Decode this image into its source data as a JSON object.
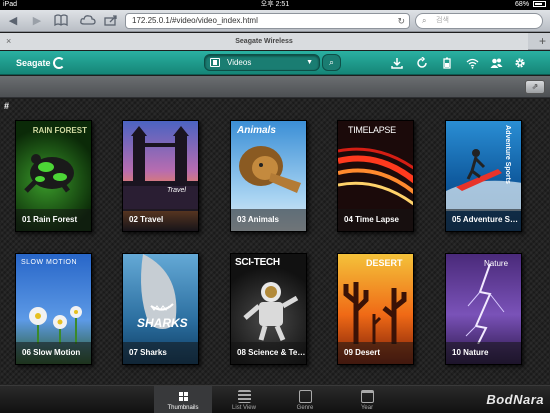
{
  "status": {
    "device": "iPad",
    "time": "오후 2:51",
    "battery": "68%"
  },
  "browser": {
    "url": "172.25.0.1/#video/video_index.html",
    "search_placeholder": "검색",
    "tab_title": "Seagate Wireless"
  },
  "app": {
    "logo": "Seagate",
    "category": "Videos",
    "header_icons": [
      "download-icon",
      "sync-icon",
      "battery-icon",
      "wifi-icon",
      "users-icon",
      "gear-icon"
    ],
    "section_index": "#"
  },
  "videos": [
    {
      "label": "01 Rain Forest",
      "poster": "RAIN FOREST"
    },
    {
      "label": "02 Travel",
      "poster": "Travel"
    },
    {
      "label": "03 Animals",
      "poster": "Animals"
    },
    {
      "label": "04 Time Lapse",
      "poster": "TIMELAPSE"
    },
    {
      "label": "05 Adventure Sp...",
      "poster": "Adventure Sports"
    },
    {
      "label": "06 Slow Motion",
      "poster": "SLOW MOTION"
    },
    {
      "label": "07 Sharks",
      "poster": "SHARKS"
    },
    {
      "label": "08 Science & Tec...",
      "poster": "SCI-TECH"
    },
    {
      "label": "09 Desert",
      "poster": "DESERT"
    },
    {
      "label": "10 Nature",
      "poster": "Nature"
    }
  ],
  "bottom_tabs": [
    {
      "label": "Thumbnails",
      "active": true
    },
    {
      "label": "List View",
      "active": false
    },
    {
      "label": "Genre",
      "active": false
    },
    {
      "label": "Year",
      "active": false
    }
  ],
  "watermark": "BodNara"
}
